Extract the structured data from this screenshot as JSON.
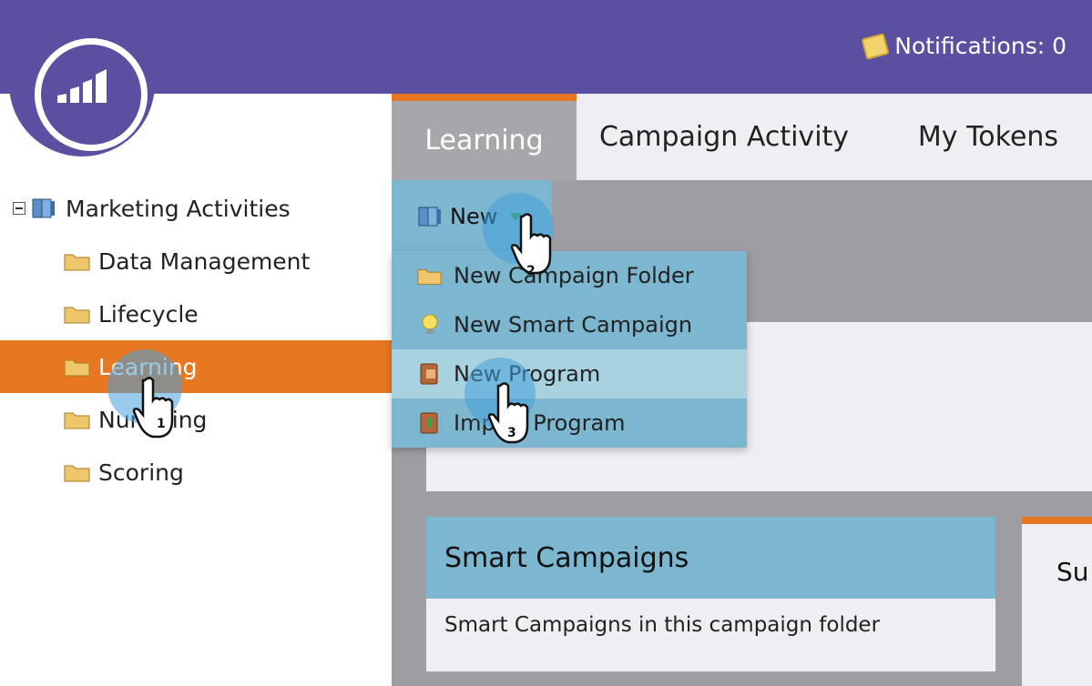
{
  "header": {
    "notifications_label": "Notifications: 0",
    "colors": {
      "bar": "#5b4fa1",
      "accent": "#e87722",
      "panel": "#7cb6cf"
    }
  },
  "tree": {
    "root_label": "Marketing Activities",
    "items": [
      {
        "label": "Data Management",
        "selected": false
      },
      {
        "label": "Lifecycle",
        "selected": false
      },
      {
        "label": "Learning",
        "selected": true
      },
      {
        "label": "Nurturing",
        "selected": false
      },
      {
        "label": "Scoring",
        "selected": false
      }
    ]
  },
  "tabs": [
    {
      "label": "Learning",
      "active": true
    },
    {
      "label": "Campaign Activity",
      "active": false
    },
    {
      "label": "My Tokens",
      "active": false
    }
  ],
  "toolbar": {
    "new_label": "New"
  },
  "menu": {
    "items": [
      {
        "label": "New Campaign Folder",
        "icon": "folder-icon"
      },
      {
        "label": "New Smart Campaign",
        "icon": "lightbulb-icon"
      },
      {
        "label": "New Program",
        "icon": "program-icon",
        "hover": true
      },
      {
        "label": "Import Program",
        "icon": "import-icon"
      }
    ]
  },
  "cards": {
    "smart_title": "Smart Campaigns",
    "smart_body": "Smart Campaigns in this campaign folder",
    "summary_label": "Su"
  },
  "annotations": {
    "step1": "1",
    "step2": "2",
    "step3": "3"
  }
}
